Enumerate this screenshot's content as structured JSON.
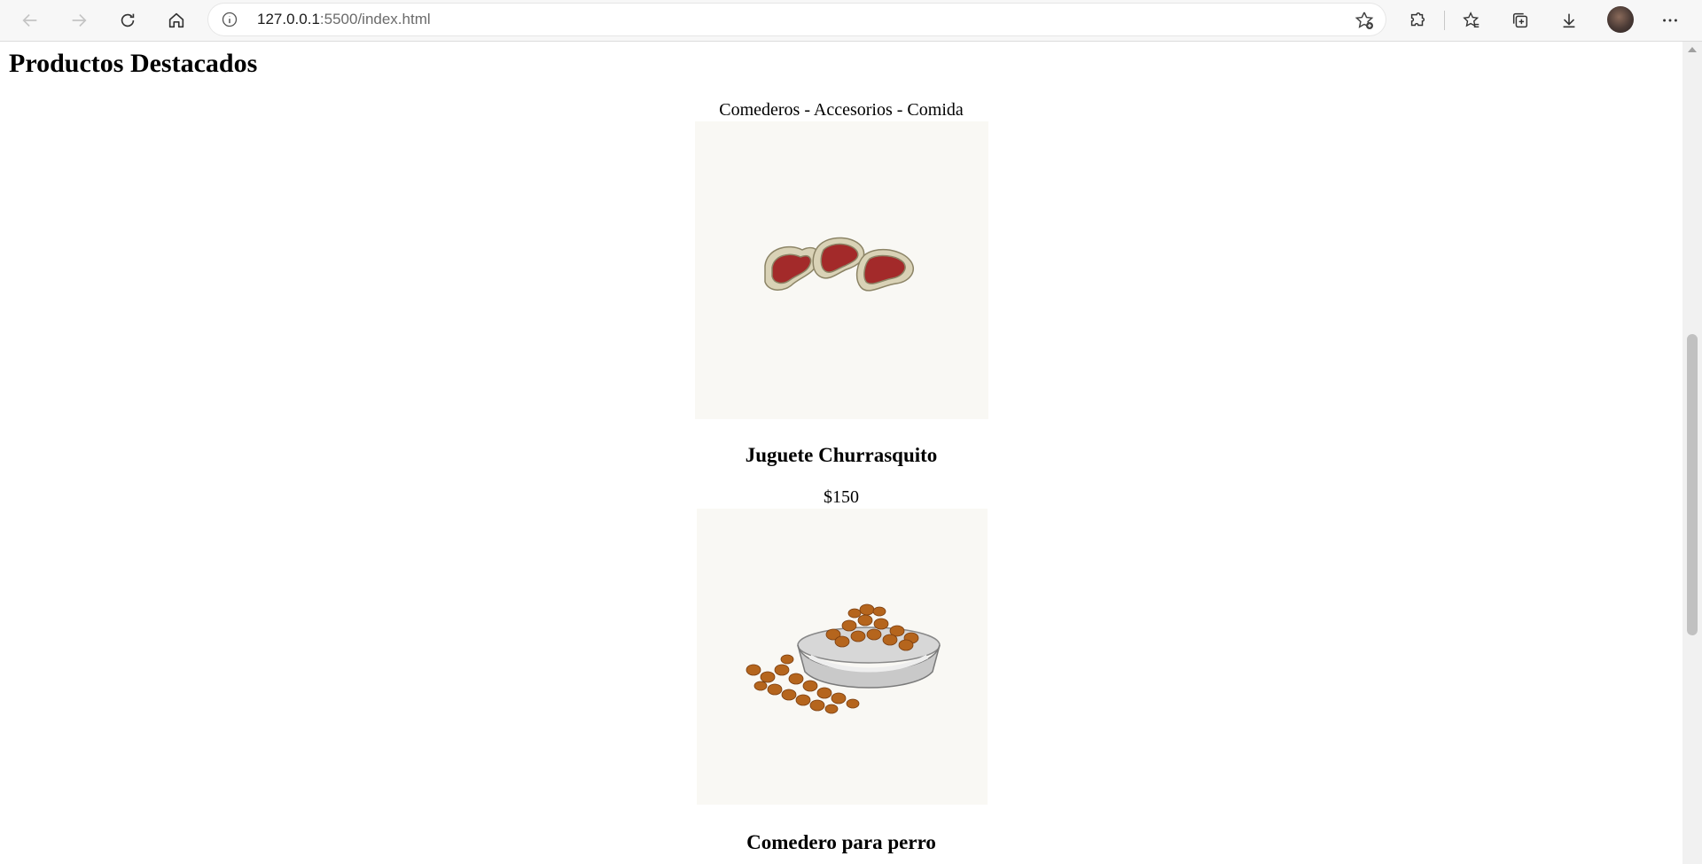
{
  "browser": {
    "url_host": "127.0.0.1",
    "url_rest": ":5500/index.html"
  },
  "page": {
    "heading": "Productos Destacados",
    "nav_text": "Comederos - Accesorios - Comida",
    "products": [
      {
        "title": "Juguete Churrasquito",
        "price": "$150",
        "image": "steak-toy-image"
      },
      {
        "title": "Comedero para perro",
        "image": "dog-food-bowl-image"
      }
    ]
  },
  "colors": {
    "image_background": "#f9f8f4",
    "toolbar": "#f7f7f7"
  }
}
